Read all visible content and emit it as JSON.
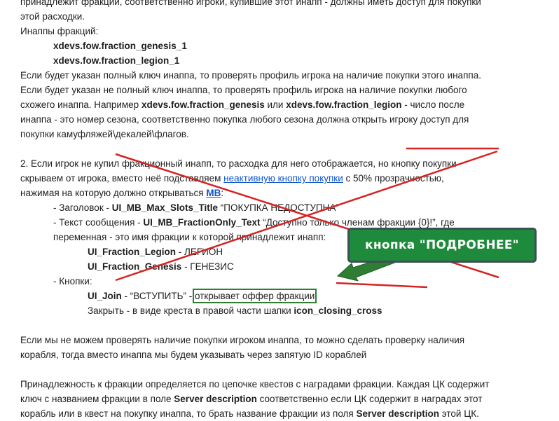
{
  "lines": {
    "l01": "принадлежит фракции, соответственно игроки, купившие этот инапп - должны иметь доступ для покупки",
    "l02": "этой расходки.",
    "l03": "Инаппы фракций:",
    "l04": "xdevs.fow.fraction_genesis_1",
    "l05": "xdevs.fow.fraction_legion_1",
    "l06": "Если будет указан полный ключ инаппа, то проверять профиль игрока на наличие покупки этого инаппа.",
    "l07": "Если будет указан не полный ключ инаппа, то проверять профиль игрока на наличие покупки любого",
    "l08a": "схожего инаппа. Например ",
    "l08b": "xdevs.fow.fraction_genesis",
    "l08c": " или ",
    "l08d": "xdevs.fow.fraction_legion",
    "l08e": " - число после",
    "l09": "инаппа - это номер сезона, соответственно покупка любого сезона должна открыть игроку доступ для",
    "l10": "покупки камуфляжей\\декалей\\флагов.",
    "l11a": "2. Если игрок не купил фракционный инапп, то расходка для него отображается, ",
    "l11b": "но кнопку покупки",
    "l12a": "скрываем от игрока, вместо неё подставляем ",
    "l12b": "неактивную кнопку покупки",
    "l12c": " с 50% прозрачностью,",
    "l13a": "нажимая на которую должно открываться ",
    "l13b": "MB",
    "l13c": ":",
    "l14a": "- Заголовок - ",
    "l14b": "UI_MB_Max_Slots_Title",
    "l14c": " “ПОКУПКА НЕДОСТУПНА”",
    "l15a": "- Текст сообщения - ",
    "l15b": "UI_MB_FractionOnly_Text",
    "l15c": " “Доступно только членам фракции {0}!”, где",
    "l16": "переменная - это имя фракции к которой принадлежит инапп:",
    "l17a": "UI_Fraction_Legion",
    "l17b": " - ЛЕГИОН",
    "l18a": "UI_Fraction_Genesis",
    "l18b": " - ГЕНЕЗИС",
    "l19": "- Кнопки:",
    "l20a": "UI_Join",
    "l20b": " - “ВСТУПИТЬ” - ",
    "l20c": "открывает оффер фракции",
    "l21a": "Закрыть - в виде креста в правой части шапки ",
    "l21b": "icon_closing_cross",
    "l22": "Если мы не можем проверять наличие покупки игроком инаппа, то можно сделать проверку наличия",
    "l23": "корабля, тогда вместо инаппа мы будем указывать через запятую ID кораблей",
    "l24": "Принадлежность к фракции определяется по цепочке квестов с наградами фракции. Каждая ЦК содержит",
    "l25a": "ключ с названием фракции в поле ",
    "l25b": "Server description",
    "l25c": " соответственно если ЦК содержит в наградах этот",
    "l26a": "корабль или в квест на покупку инаппа, то брать название фракции из поля ",
    "l26b": "Server description",
    "l26c": " этой ЦК."
  },
  "annotation": {
    "callout_text": "кнопка \"ПОДРОБНЕЕ\"",
    "callout_color": "#1e8a3b",
    "arrow_color": "#2e7d32",
    "strike_color": "#d42323"
  }
}
